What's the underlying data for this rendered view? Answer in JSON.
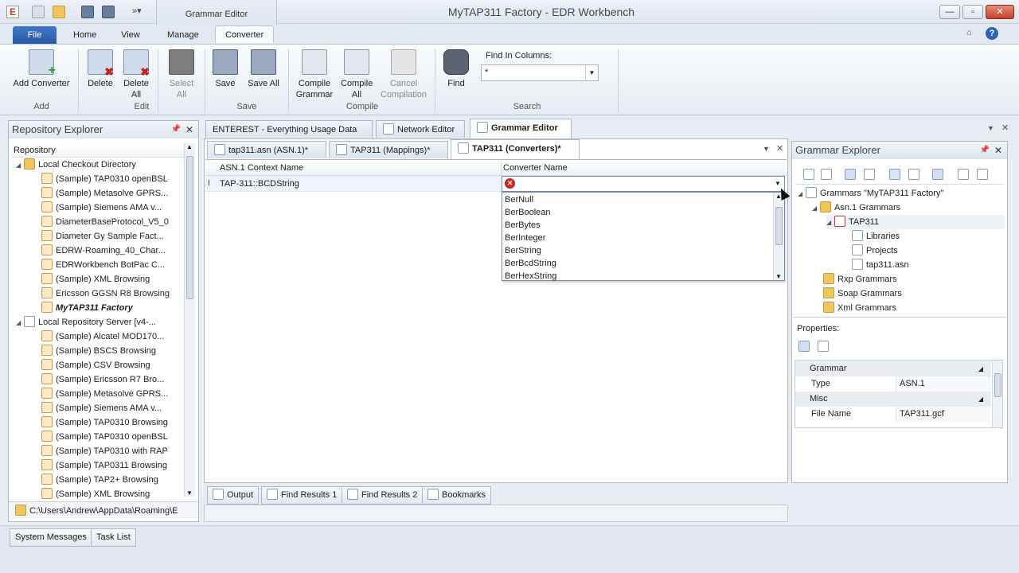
{
  "titlebar": {
    "context_tab": "Grammar Editor",
    "title": "MyTAP311 Factory - EDR Workbench",
    "app_icon": "E"
  },
  "ribbon_tabs": [
    "File",
    "Home",
    "View",
    "Manage",
    "Converter"
  ],
  "ribbon": {
    "add_converter": "Add Converter",
    "delete": "Delete",
    "delete_all": "Delete All",
    "select_all": "Select All",
    "save": "Save",
    "save_all": "Save All",
    "compile_grammar": "Compile Grammar",
    "compile_all": "Compile All",
    "cancel_compilation": "Cancel Compilation",
    "find": "Find",
    "find_in_columns_label": "Find In Columns:",
    "find_in_columns_value": "*",
    "groups": {
      "add": "Add",
      "edit": "Edit",
      "save": "Save",
      "compile": "Compile",
      "search": "Search"
    }
  },
  "repository_explorer": {
    "title": "Repository Explorer",
    "header": "Repository",
    "local_checkout": "Local Checkout Directory",
    "checkout_items": [
      "(Sample) TAP0310 openBSL",
      "(Sample) Metasolve GPRS...",
      "(Sample) Siemens AMA v...",
      "DiameterBaseProtocol_V5_0",
      "Diameter Gy Sample Fact...",
      "EDRW-Roaming_40_Char...",
      "EDRWorkbench BotPac C...",
      "(Sample) XML Browsing",
      "Ericsson GGSN R8 Browsing",
      "MyTAP311 Factory"
    ],
    "local_server": "Local Repository Server [v4-...",
    "server_items": [
      "(Sample) Alcatel MOD170...",
      "(Sample) BSCS Browsing",
      "(Sample) CSV Browsing",
      "(Sample) Ericsson R7 Bro...",
      "(Sample) Metasolve GPRS...",
      "(Sample) Siemens AMA v...",
      "(Sample) TAP0310 Browsing",
      "(Sample) TAP0310 openBSL",
      "(Sample) TAP0310 with RAP",
      "(Sample) TAP0311 Browsing",
      "(Sample) TAP2+ Browsing",
      "(Sample) XML Browsing"
    ],
    "path": "C:\\Users\\Andrew\\AppData\\Roaming\\E"
  },
  "doc_tabs": [
    "ENTEREST - Everything Usage Data",
    "Network Editor",
    "Grammar Editor"
  ],
  "editor_tabs": [
    "tap311.asn (ASN.1)*",
    "TAP311 (Mappings)*",
    "TAP311 (Converters)*"
  ],
  "grid": {
    "col1": "ASN.1 Context Name",
    "col2": "Converter Name",
    "row1": "TAP-311::BCDString"
  },
  "dropdown_items": [
    "BerNull",
    "BerBoolean",
    "BerBytes",
    "BerInteger",
    "BerString",
    "BerBcdString",
    "BerHexString"
  ],
  "bottom_tabs": [
    "Output",
    "Find Results 1",
    "Find Results 2",
    "Bookmarks"
  ],
  "grammar_explorer": {
    "title": "Grammar Explorer",
    "root": "Grammars \"MyTAP311 Factory\"",
    "asn1": "Asn.1 Grammars",
    "tap311": "TAP311",
    "libraries": "Libraries",
    "projects": "Projects",
    "tap311_asn": "tap311.asn",
    "rxp": "Rxp Grammars",
    "soap": "Soap Grammars",
    "xml": "Xml Grammars",
    "properties_label": "Properties:",
    "prop_cat1": "Grammar",
    "prop_type_label": "Type",
    "prop_type_value": "ASN.1",
    "prop_cat2": "Misc",
    "prop_file_label": "File Name",
    "prop_file_value": "TAP311.gcf"
  },
  "status_tabs": [
    "System Messages",
    "Task List"
  ],
  "colors": {
    "accent": "#2a5aa5",
    "error": "#cc2222"
  }
}
